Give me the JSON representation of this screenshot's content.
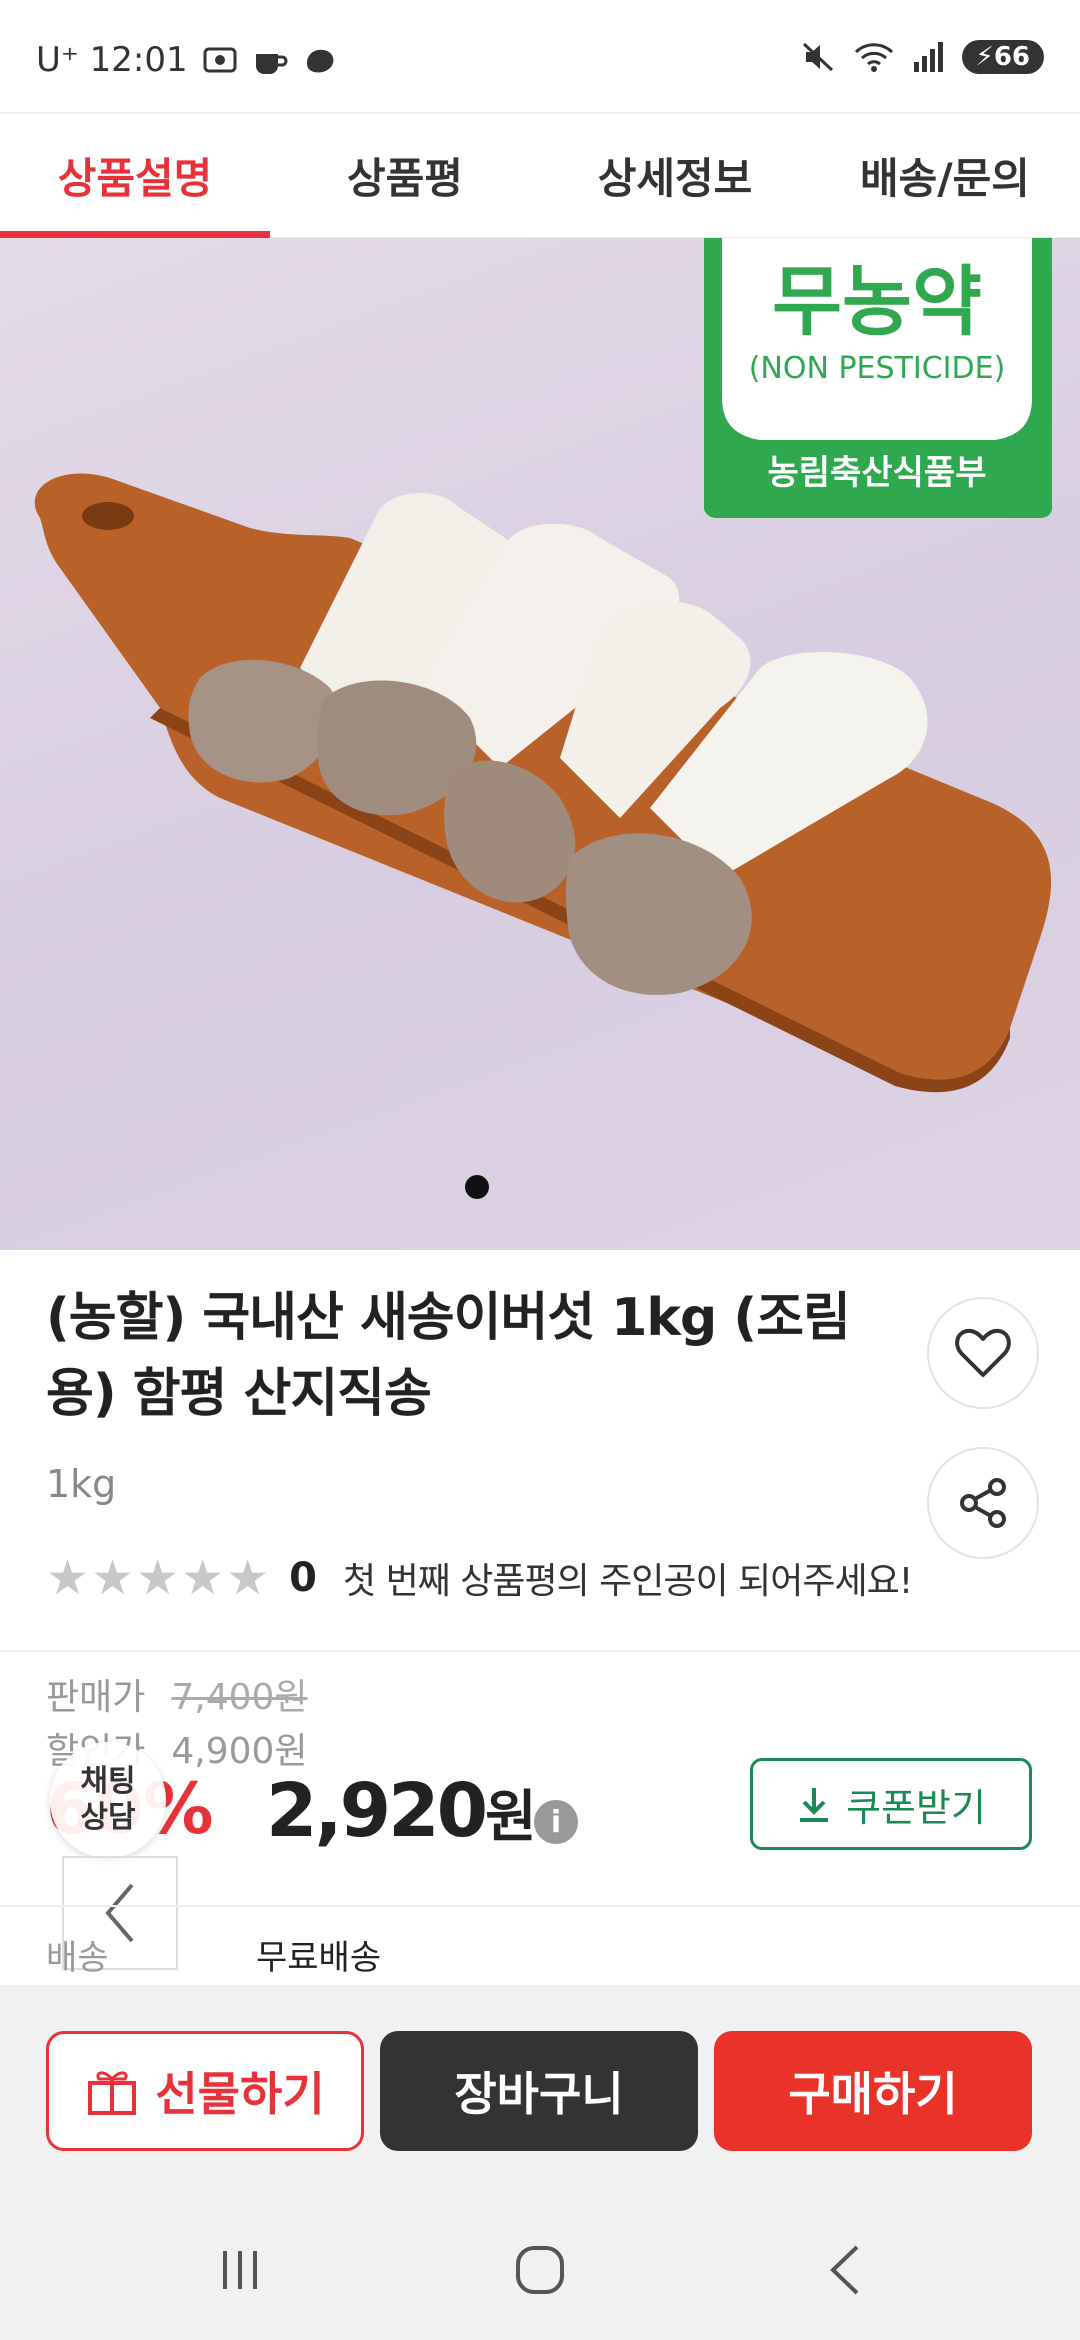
{
  "status_bar": {
    "carrier_time": "U⁺ 12:01",
    "battery": "66"
  },
  "tabs": [
    {
      "label": "상품설명",
      "active": true
    },
    {
      "label": "상품평",
      "active": false
    },
    {
      "label": "상세정보",
      "active": false
    },
    {
      "label": "배송/문의",
      "active": false
    }
  ],
  "hero": {
    "badge_title": "무농약",
    "badge_subtitle": "(NON PESTICIDE)",
    "badge_issuer": "농림축산식품부",
    "image_subject": "mushrooms-on-cutting-board",
    "carousel_pages": 1,
    "carousel_current": 1
  },
  "product": {
    "title": "(농할) 국내산 새송이버섯 1kg (조림용) 함평 산지직송",
    "option": "1kg",
    "rating_value": 0,
    "review_count": "0",
    "review_message": "첫 번째 상품평의 주인공이 되어주세요!"
  },
  "price": {
    "sale_label": "판매가",
    "sale_price": "7,400원",
    "discount_label": "할인가",
    "discount_price": "4,900원",
    "discount_rate": "60%",
    "final_price": "2,920",
    "currency": "원",
    "info_icon": "i",
    "coupon_label": "쿠폰받기"
  },
  "chat": {
    "line1": "채팅",
    "line2": "상담"
  },
  "shipping": {
    "label": "배송",
    "value": "무료배송"
  },
  "actions": {
    "gift_label": "선물하기",
    "cart_label": "장바구니",
    "buy_label": "구매하기"
  },
  "colors": {
    "accent_red": "#e8323a",
    "coupon_green": "#1a8a52",
    "badge_green": "#2fa84f",
    "dark_button": "#333333"
  }
}
